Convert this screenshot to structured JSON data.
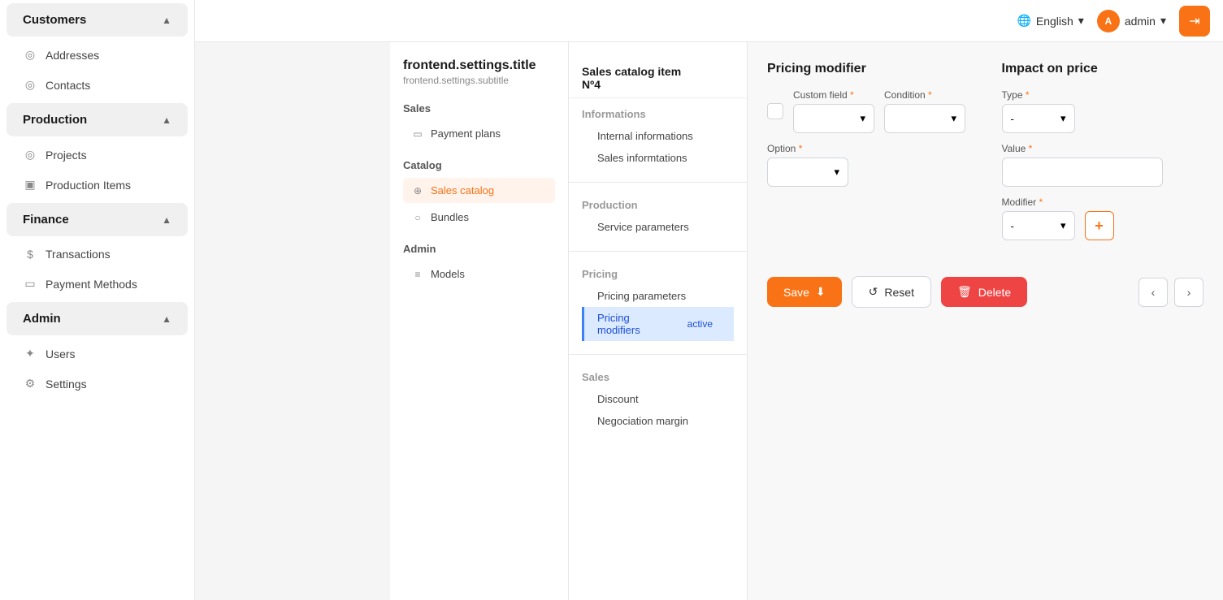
{
  "topnav": {
    "language": "English",
    "admin_label": "admin",
    "logout_icon": "→"
  },
  "sidebar": {
    "sections": [
      {
        "id": "customers",
        "label": "Customers",
        "expanded": true,
        "items": [
          {
            "id": "addresses",
            "label": "Addresses",
            "icon": "◎"
          },
          {
            "id": "contacts",
            "label": "Contacts",
            "icon": "◎"
          }
        ]
      },
      {
        "id": "production",
        "label": "Production",
        "expanded": true,
        "items": [
          {
            "id": "projects",
            "label": "Projects",
            "icon": "◎"
          },
          {
            "id": "production-items",
            "label": "Production Items",
            "icon": "▣"
          }
        ]
      },
      {
        "id": "finance",
        "label": "Finance",
        "expanded": true,
        "items": [
          {
            "id": "transactions",
            "label": "Transactions",
            "icon": "$"
          },
          {
            "id": "payment-methods",
            "label": "Payment Methods",
            "icon": "▭"
          }
        ]
      },
      {
        "id": "admin",
        "label": "Admin",
        "expanded": true,
        "items": [
          {
            "id": "users",
            "label": "Users",
            "icon": "✦"
          },
          {
            "id": "settings",
            "label": "Settings",
            "icon": "⚙"
          }
        ]
      }
    ]
  },
  "settings": {
    "title": "frontend.settings.title",
    "subtitle": "frontend.settings.subtitle",
    "sections": [
      {
        "label": "Sales",
        "items": [
          {
            "id": "payment-plans",
            "label": "Payment plans",
            "icon": "▭",
            "active": false
          }
        ]
      },
      {
        "label": "Catalog",
        "items": [
          {
            "id": "sales-catalog",
            "label": "Sales catalog",
            "icon": "⊕",
            "active": true
          },
          {
            "id": "bundles",
            "label": "Bundles",
            "icon": "○",
            "active": false
          }
        ]
      },
      {
        "label": "Admin",
        "items": [
          {
            "id": "models",
            "label": "Models",
            "icon": "≡",
            "active": false
          }
        ]
      }
    ]
  },
  "catalog_item": {
    "title": "Sales catalog item",
    "number": "Nº4",
    "tabs": [
      {
        "section": "Informations",
        "items": [
          "Internal informations",
          "Sales informtations"
        ]
      },
      {
        "section": "Production",
        "items": [
          "Service parameters"
        ]
      },
      {
        "section": "Pricing",
        "items": [
          "Pricing parameters",
          "Pricing modifiers"
        ]
      },
      {
        "section": "Sales",
        "items": [
          "Discount",
          "Negociation margin"
        ]
      }
    ],
    "active_tab": "Pricing modifiers"
  },
  "pricing_modifier": {
    "section_title": "Pricing modifier",
    "fields": [
      {
        "id": "custom-field",
        "label": "Custom field",
        "required": true
      },
      {
        "id": "condition",
        "label": "Condition",
        "required": true
      },
      {
        "id": "option",
        "label": "Option",
        "required": true
      }
    ],
    "impact_title": "Impact on price",
    "impact_fields": [
      {
        "id": "type",
        "label": "Type",
        "required": true
      },
      {
        "id": "value",
        "label": "Value",
        "required": true
      },
      {
        "id": "modifier",
        "label": "Modifier",
        "required": true
      }
    ]
  },
  "buttons": {
    "save": "Save",
    "reset": "Reset",
    "delete": "Delete",
    "prev": "‹",
    "next": "›",
    "add": "+"
  }
}
